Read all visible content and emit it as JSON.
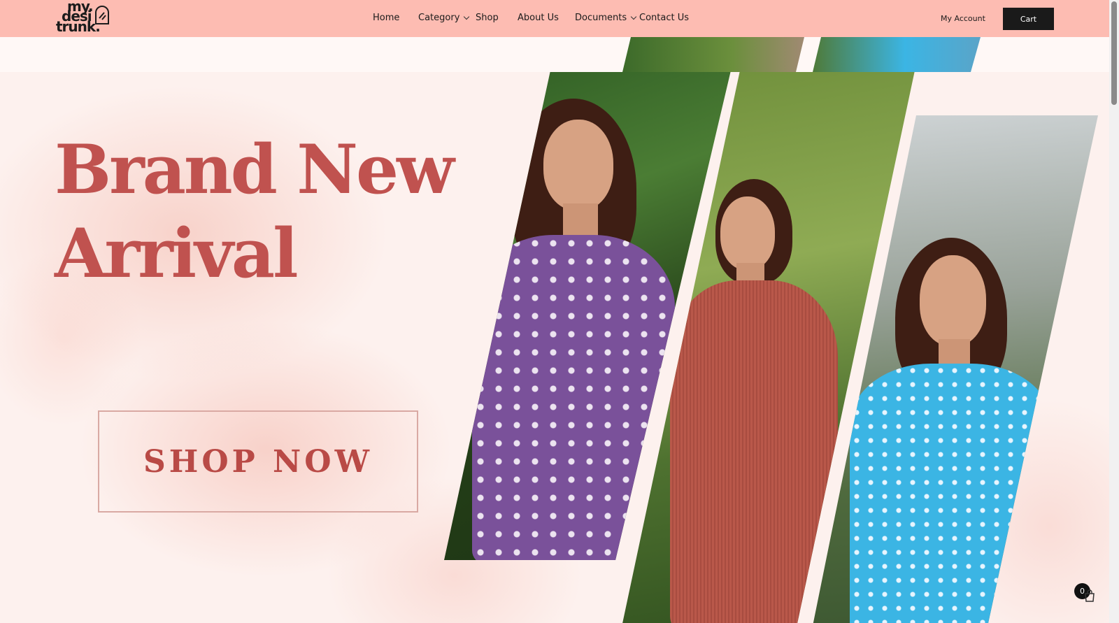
{
  "brand": {
    "logo_line1": "my.",
    "logo_line2": "desi",
    "logo_line3": "trunk."
  },
  "nav": {
    "items": [
      {
        "label": "Home"
      },
      {
        "label": "Category",
        "has_dropdown": true
      },
      {
        "label": "Shop"
      },
      {
        "label": "About Us"
      },
      {
        "label": "Documents",
        "has_dropdown": true
      },
      {
        "label": "Contact Us"
      }
    ],
    "my_account": "My Account",
    "cart_label": "Cart"
  },
  "hero": {
    "headline_line1": "Brand New",
    "headline_line2": "Arrival",
    "cta_label": "SHOP NOW"
  },
  "floating_cart": {
    "count": "0",
    "icon": "shopping-bag-icon"
  },
  "colors": {
    "header_bg": "#fdbcb2",
    "accent": "#c0524f",
    "cart_bg": "#1a1a1a"
  }
}
